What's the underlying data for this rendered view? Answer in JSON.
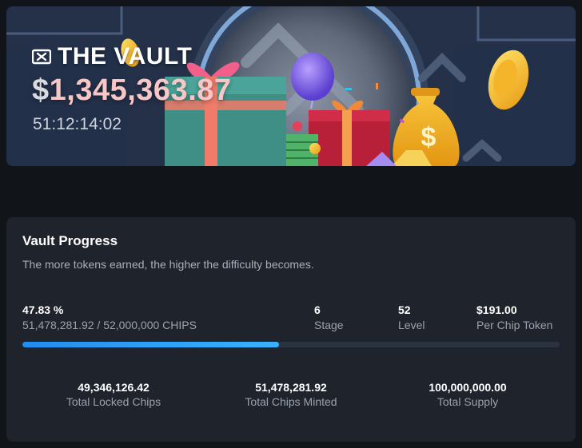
{
  "banner": {
    "title": "THE VAULT",
    "jackpot_symbol": "$",
    "jackpot_amount": "1,345,363.87",
    "countdown": "51:12:14:02",
    "icon": "ticket-icon"
  },
  "panel": {
    "title": "Vault Progress",
    "subtitle": "The more tokens earned, the higher the difficulty becomes.",
    "progress": {
      "percent_label": "47.83 %",
      "detail": "51,478,281.92 / 52,000,000 CHIPS",
      "fraction": 0.4783
    },
    "stats": [
      {
        "value": "6",
        "label": "Stage"
      },
      {
        "value": "52",
        "label": "Level"
      },
      {
        "value": "$191.00",
        "label": "Per Chip Token"
      }
    ],
    "totals": [
      {
        "value": "49,346,126.42",
        "label": "Total Locked Chips"
      },
      {
        "value": "51,478,281.92",
        "label": "Total Chips Minted"
      },
      {
        "value": "100,000,000.00",
        "label": "Total Supply"
      }
    ]
  },
  "colors": {
    "background": "#111418",
    "panel": "#1e232c",
    "accent": "#2a9df4",
    "jackpot": "#f7c7c7"
  }
}
